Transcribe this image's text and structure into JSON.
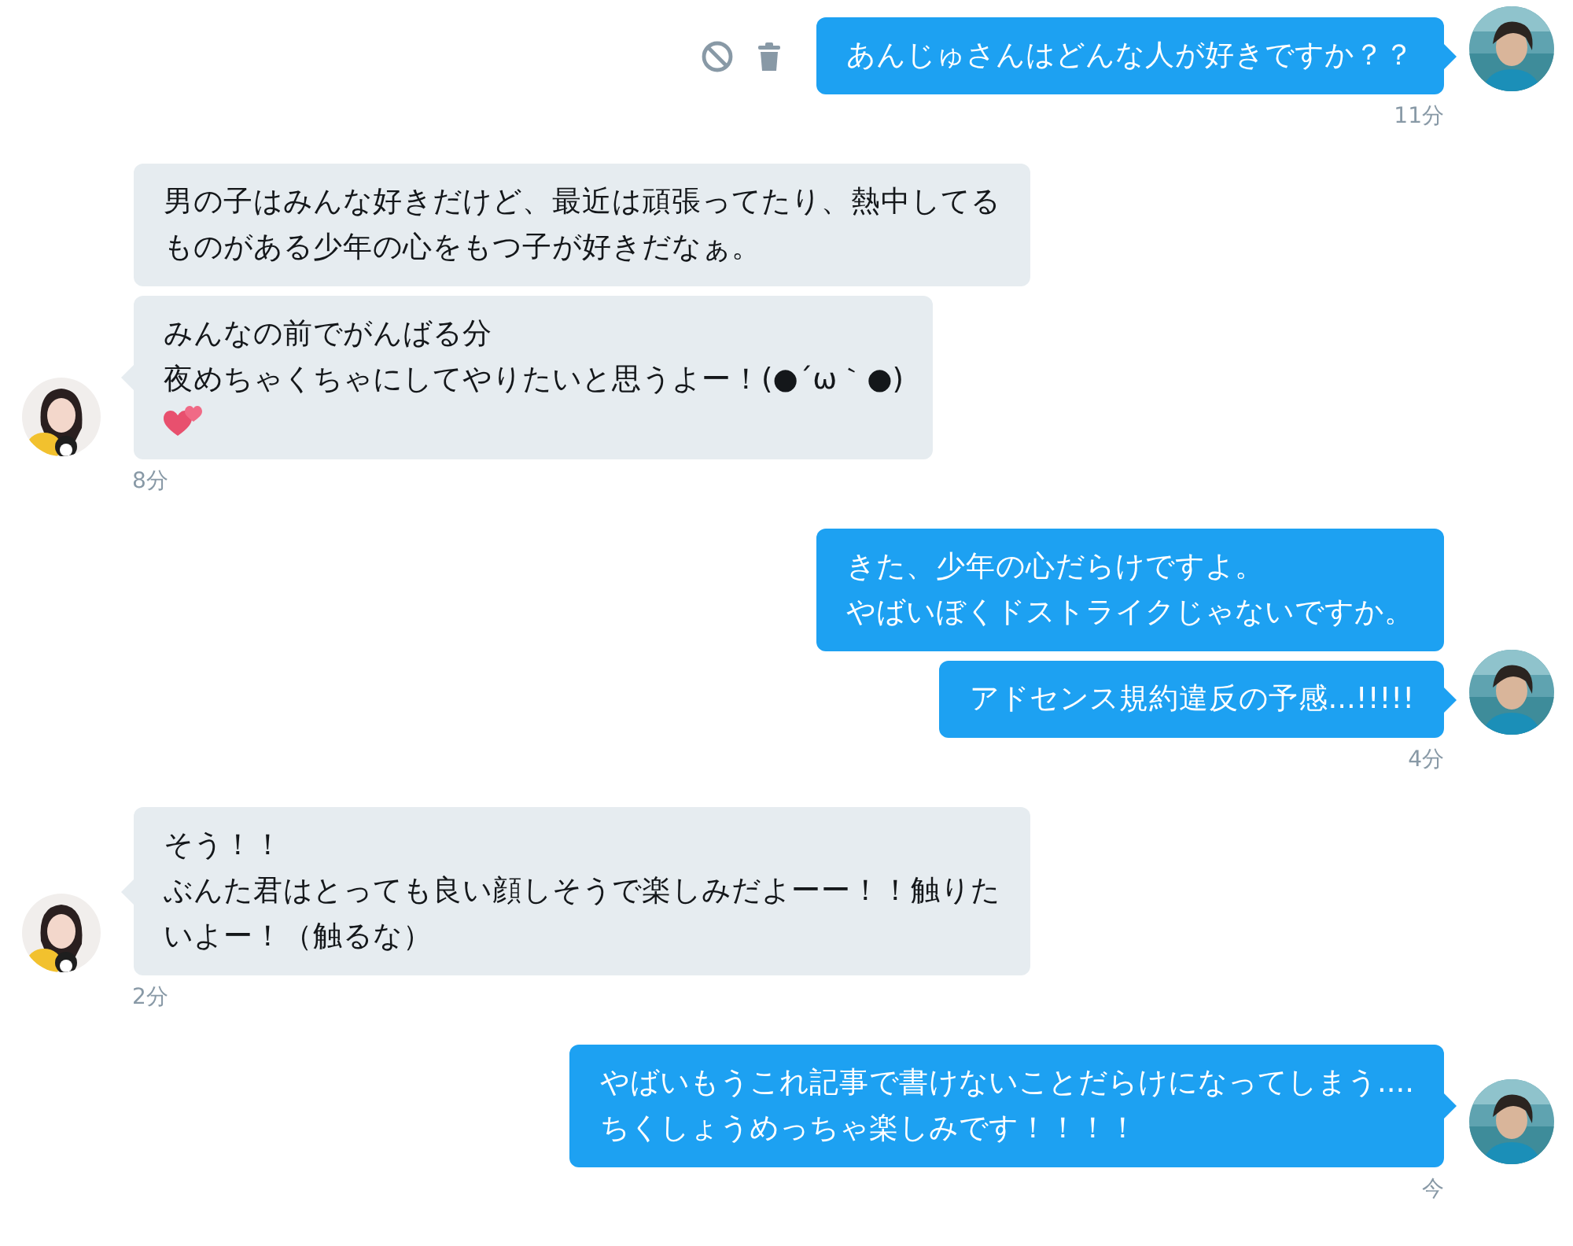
{
  "conversation": [
    {
      "kind": "sent",
      "messages": [
        {
          "lines": [
            "あんじゅさんはどんな人が好きですか？？"
          ],
          "show_actions": true
        }
      ],
      "time": "11分"
    },
    {
      "kind": "received",
      "messages": [
        {
          "lines": [
            "男の子はみんな好きだけど、最近は頑張ってたり、熱中してる",
            "ものがある少年の心をもつ子が好きだなぁ。"
          ]
        },
        {
          "lines": [
            "みんなの前でがんばる分",
            "夜めちゃくちゃにしてやりたいと思うよー！(●´ω｀●)"
          ],
          "hearts_emoji": true
        }
      ],
      "time": "8分"
    },
    {
      "kind": "sent",
      "messages": [
        {
          "lines": [
            "きた、少年の心だらけですよ。",
            "やばいぼくドストライクじゃないですか。"
          ]
        },
        {
          "lines": [
            "アドセンス規約違反の予感...!!!!!"
          ]
        }
      ],
      "time": "4分"
    },
    {
      "kind": "received",
      "messages": [
        {
          "lines": [
            "そう！！",
            "ぶんた君はとっても良い顔しそうで楽しみだよーー！！触りた",
            "いよー！（触るな）"
          ]
        }
      ],
      "time": "2分"
    },
    {
      "kind": "sent",
      "messages": [
        {
          "lines": [
            "やばいもうこれ記事で書けないことだらけになってしまう....",
            "ちくしょうめっちゃ楽しみです！！！！"
          ]
        }
      ],
      "time": "今"
    }
  ]
}
